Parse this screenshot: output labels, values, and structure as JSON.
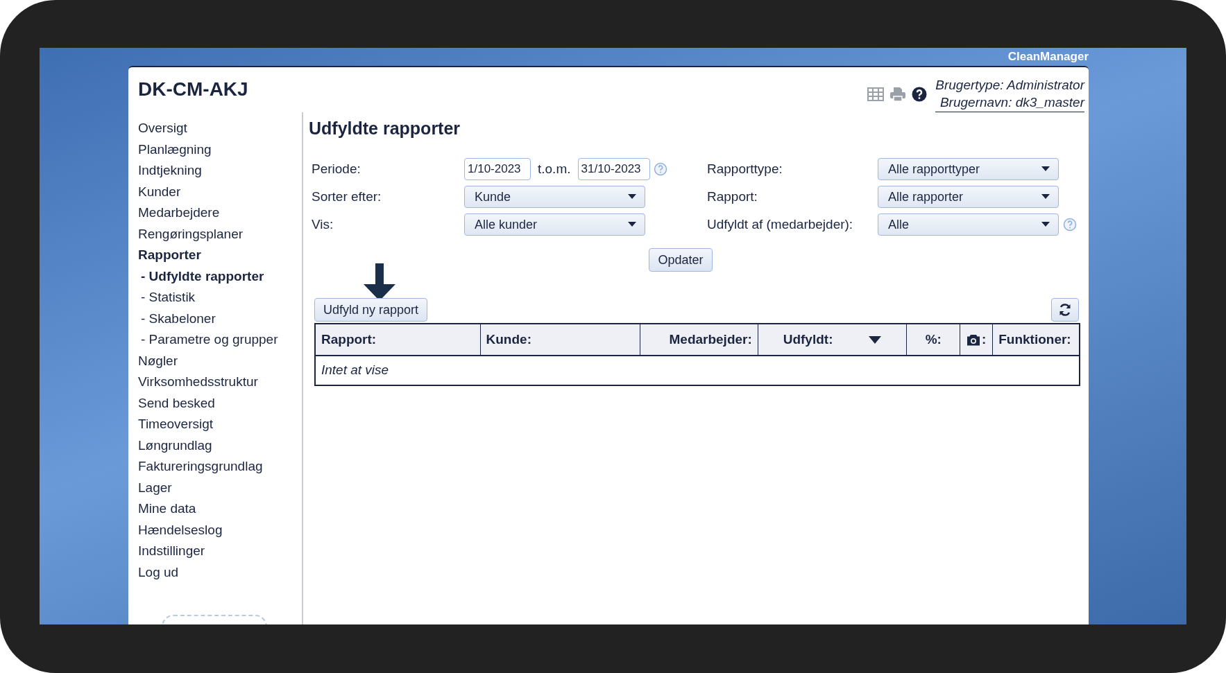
{
  "brand": "CleanManager",
  "header": {
    "title": "DK-CM-AKJ",
    "user_type": "Brugertype: Administrator",
    "username": "Brugernavn: dk3_master"
  },
  "sidebar": {
    "items": [
      {
        "label": "Oversigt",
        "selected": false
      },
      {
        "label": "Planlægning",
        "selected": false
      },
      {
        "label": "Indtjekning",
        "selected": false
      },
      {
        "label": "Kunder",
        "selected": false
      },
      {
        "label": "Medarbejdere",
        "selected": false
      },
      {
        "label": "Rengøringsplaner",
        "selected": false
      },
      {
        "label": "Rapporter",
        "selected": true,
        "children": [
          {
            "label": "- Udfyldte rapporter",
            "selected": true
          },
          {
            "label": "- Statistik",
            "selected": false
          },
          {
            "label": "- Skabeloner",
            "selected": false
          },
          {
            "label": "- Parametre og grupper",
            "selected": false
          }
        ]
      },
      {
        "label": "Nøgler",
        "selected": false
      },
      {
        "label": "Virksomhedsstruktur",
        "selected": false
      },
      {
        "label": "Send besked",
        "selected": false
      },
      {
        "label": "Timeoversigt",
        "selected": false
      },
      {
        "label": "Løngrundlag",
        "selected": false
      },
      {
        "label": "Faktureringsgrundlag",
        "selected": false
      },
      {
        "label": "Lager",
        "selected": false
      },
      {
        "label": "Mine data",
        "selected": false
      },
      {
        "label": "Hændelseslog",
        "selected": false
      },
      {
        "label": "Indstillinger",
        "selected": false
      },
      {
        "label": "Log ud",
        "selected": false
      }
    ]
  },
  "page_title": "Udfyldte rapporter",
  "filters": {
    "period": {
      "label": "Periode:",
      "from": "1/10-2023",
      "separator": "t.o.m.",
      "to": "31/10-2023"
    },
    "sort": {
      "label": "Sorter efter:",
      "value": "Kunde"
    },
    "show": {
      "label": "Vis:",
      "value": "Alle kunder"
    },
    "report_type": {
      "label": "Rapporttype:",
      "value": "Alle rapporttyper"
    },
    "report": {
      "label": "Rapport:",
      "value": "Alle rapporter"
    },
    "filled_by": {
      "label": "Udfyldt af (medarbejder):",
      "value": "Alle"
    }
  },
  "update_button": "Opdater",
  "new_report_button": "Udfyld ny rapport",
  "table": {
    "columns": [
      {
        "kind": "text",
        "label": "Rapport:",
        "sorted": false
      },
      {
        "kind": "text",
        "label": "Kunde:",
        "sorted": false
      },
      {
        "kind": "text",
        "label": "Medarbejder:",
        "sorted": false
      },
      {
        "kind": "text",
        "label": "Udfyldt:",
        "sorted": true
      },
      {
        "kind": "text",
        "label": "%:",
        "sorted": false
      },
      {
        "kind": "camera",
        "label": ":",
        "sorted": false
      },
      {
        "kind": "text",
        "label": "Funktioner:",
        "sorted": false
      }
    ],
    "empty_text": "Intet at vise"
  }
}
